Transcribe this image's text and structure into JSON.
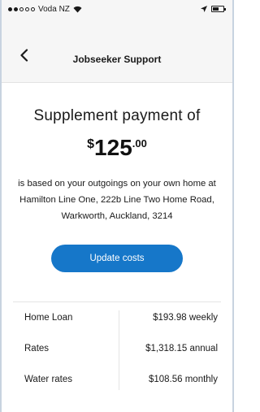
{
  "status_bar": {
    "carrier": "Voda NZ"
  },
  "nav": {
    "title": "Jobseeker Support"
  },
  "summary": {
    "headline": "Supplement payment of",
    "currency": "$",
    "amount_main": "125",
    "amount_cents": ".00",
    "description": "is based on your outgoings on your own home at Hamilton Line One, 222b Line Two Home Road, Warkworth, Auckland, 3214"
  },
  "actions": {
    "update_label": "Update costs"
  },
  "costs": [
    {
      "label": "Home Loan",
      "value": "$193.98 weekly"
    },
    {
      "label": "Rates",
      "value": "$1,318.15 annual"
    },
    {
      "label": "Water rates",
      "value": "$108.56 monthly"
    }
  ],
  "colors": {
    "accent": "#1677c9",
    "header_bg": "#f6f6f6"
  }
}
